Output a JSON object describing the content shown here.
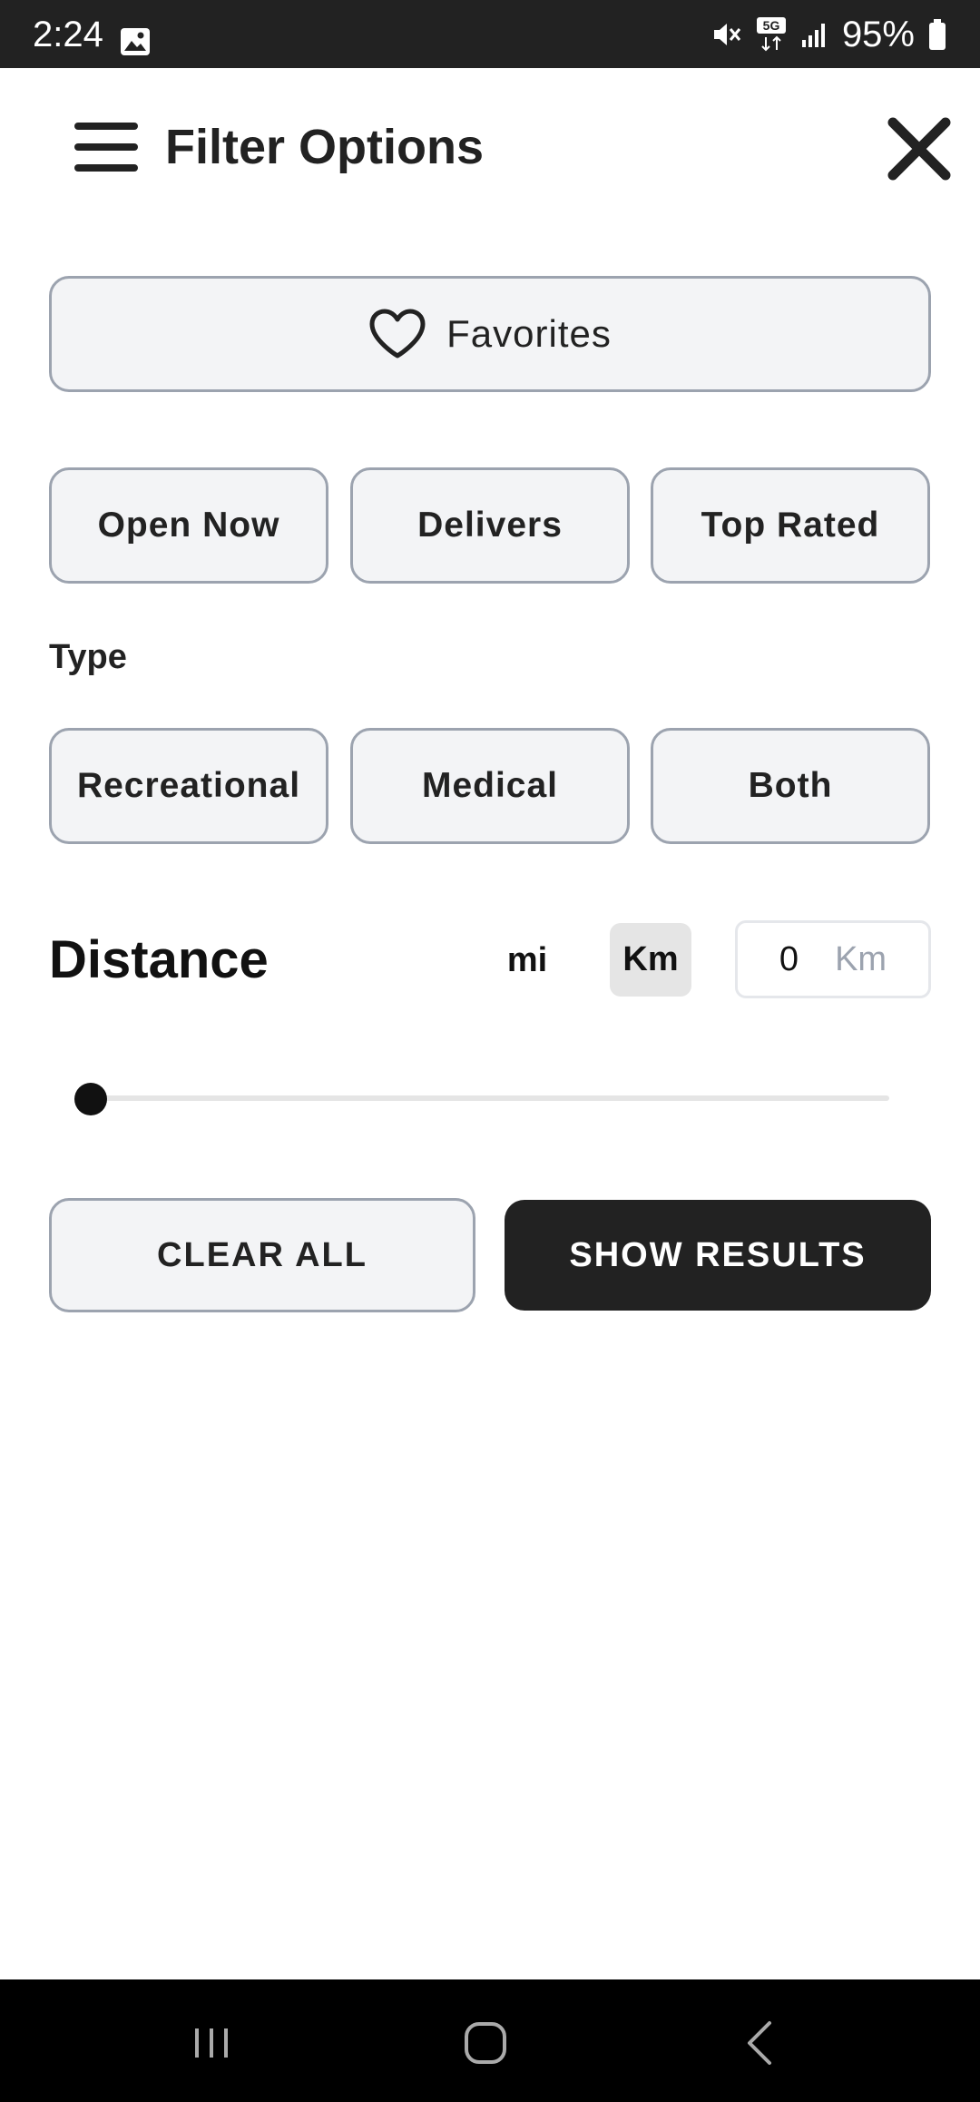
{
  "status_bar": {
    "time": "2:24",
    "battery": "95%",
    "icons": [
      "gallery-icon",
      "mute-icon",
      "5g-icon",
      "signal-icon",
      "battery-icon"
    ]
  },
  "header": {
    "title": "Filter Options",
    "menu_icon": "hamburger-icon",
    "close_icon": "close-icon"
  },
  "favorites": {
    "label": "Favorites",
    "icon": "heart-icon"
  },
  "quick_filters": [
    {
      "label": "Open Now"
    },
    {
      "label": "Delivers"
    },
    {
      "label": "Top Rated"
    }
  ],
  "type_section": {
    "label": "Type",
    "options": [
      {
        "label": "Recreational"
      },
      {
        "label": "Medical"
      },
      {
        "label": "Both"
      }
    ]
  },
  "distance": {
    "label": "Distance",
    "units": {
      "mi": "mi",
      "km": "Km",
      "selected": "Km"
    },
    "input_value": "0",
    "input_unit": "Km",
    "slider_fraction": 0
  },
  "actions": {
    "clear": "CLEAR ALL",
    "show": "SHOW RESULTS"
  },
  "colors": {
    "status_bar_bg": "#222222",
    "button_bg": "#f3f4f6",
    "button_border": "#9ca3af",
    "primary_dark": "#222222",
    "selected_unit_bg": "#e5e5e5",
    "nav_bar_bg": "#000000"
  },
  "nav_bar": {
    "icons": [
      "recent-apps-icon",
      "home-icon",
      "back-icon"
    ]
  }
}
